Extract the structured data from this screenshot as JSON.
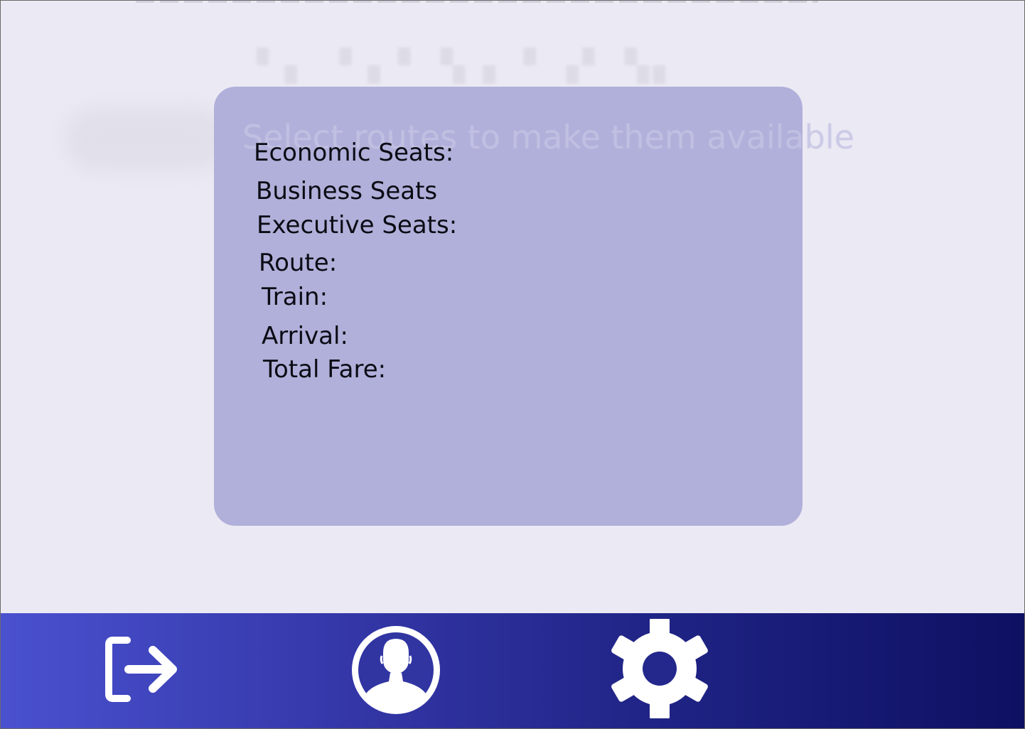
{
  "details_card": {
    "placeholder_hint": "Select routes to make them available",
    "fields": {
      "economic_seats": "Economic Seats:",
      "business_seats": "Business Seats",
      "executive_seats": "Executive Seats:",
      "route": "Route:",
      "train": "Train:",
      "arrival": "Arrival:",
      "total_fare": "Total Fare:"
    }
  },
  "bottom_nav": {
    "items": [
      {
        "icon": "logout-icon"
      },
      {
        "icon": "user-profile-icon"
      },
      {
        "icon": "settings-gear-icon"
      }
    ]
  },
  "colors": {
    "page_background": "#ebe9f3",
    "card_background": "#b1b0da",
    "nav_gradient_start": "#4a51cf",
    "nav_gradient_end": "#0e1062",
    "icon_color": "#ffffff",
    "label_color": "#0b0b14"
  }
}
